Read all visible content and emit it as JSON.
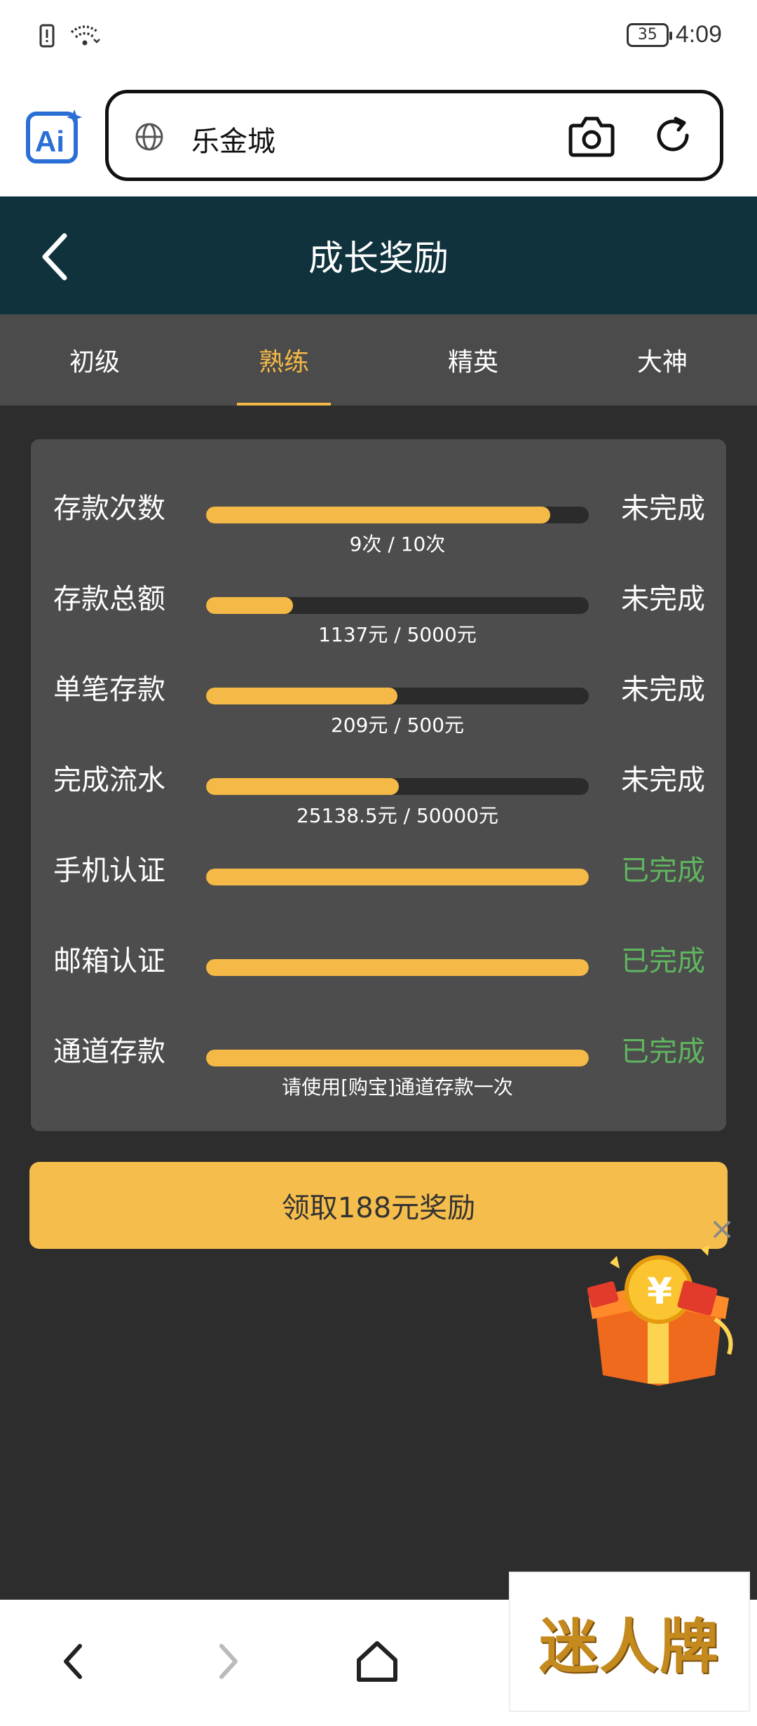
{
  "status_bar": {
    "battery": "35",
    "time": "4:09"
  },
  "browser": {
    "url_text": "乐金城"
  },
  "header": {
    "title": "成长奖励"
  },
  "tabs": [
    {
      "label": "初级",
      "active": false
    },
    {
      "label": "熟练",
      "active": true
    },
    {
      "label": "精英",
      "active": false
    },
    {
      "label": "大神",
      "active": false
    }
  ],
  "tasks": [
    {
      "label": "存款次数",
      "progress": 0.9,
      "detail": "9次 / 10次",
      "status": "未完成",
      "completed": false
    },
    {
      "label": "存款总额",
      "progress": 0.227,
      "detail": "1137元 / 5000元",
      "status": "未完成",
      "completed": false
    },
    {
      "label": "单笔存款",
      "progress": 0.5,
      "detail": "209元 / 500元",
      "status": "未完成",
      "completed": false
    },
    {
      "label": "完成流水",
      "progress": 0.503,
      "detail": "25138.5元 / 50000元",
      "status": "未完成",
      "completed": false
    },
    {
      "label": "手机认证",
      "progress": 1.0,
      "detail": "",
      "status": "已完成",
      "completed": true
    },
    {
      "label": "邮箱认证",
      "progress": 1.0,
      "detail": "",
      "status": "已完成",
      "completed": true
    },
    {
      "label": "通道存款",
      "progress": 1.0,
      "detail": "请使用[购宝]通道存款一次",
      "status": "已完成",
      "completed": true
    }
  ],
  "claim_button": {
    "label": "领取188元奖励"
  },
  "ad_badge": {
    "text": "迷人牌"
  },
  "colors": {
    "accent": "#f5b947",
    "header_bg": "#0f323d",
    "complete_green": "#5fb65f"
  }
}
